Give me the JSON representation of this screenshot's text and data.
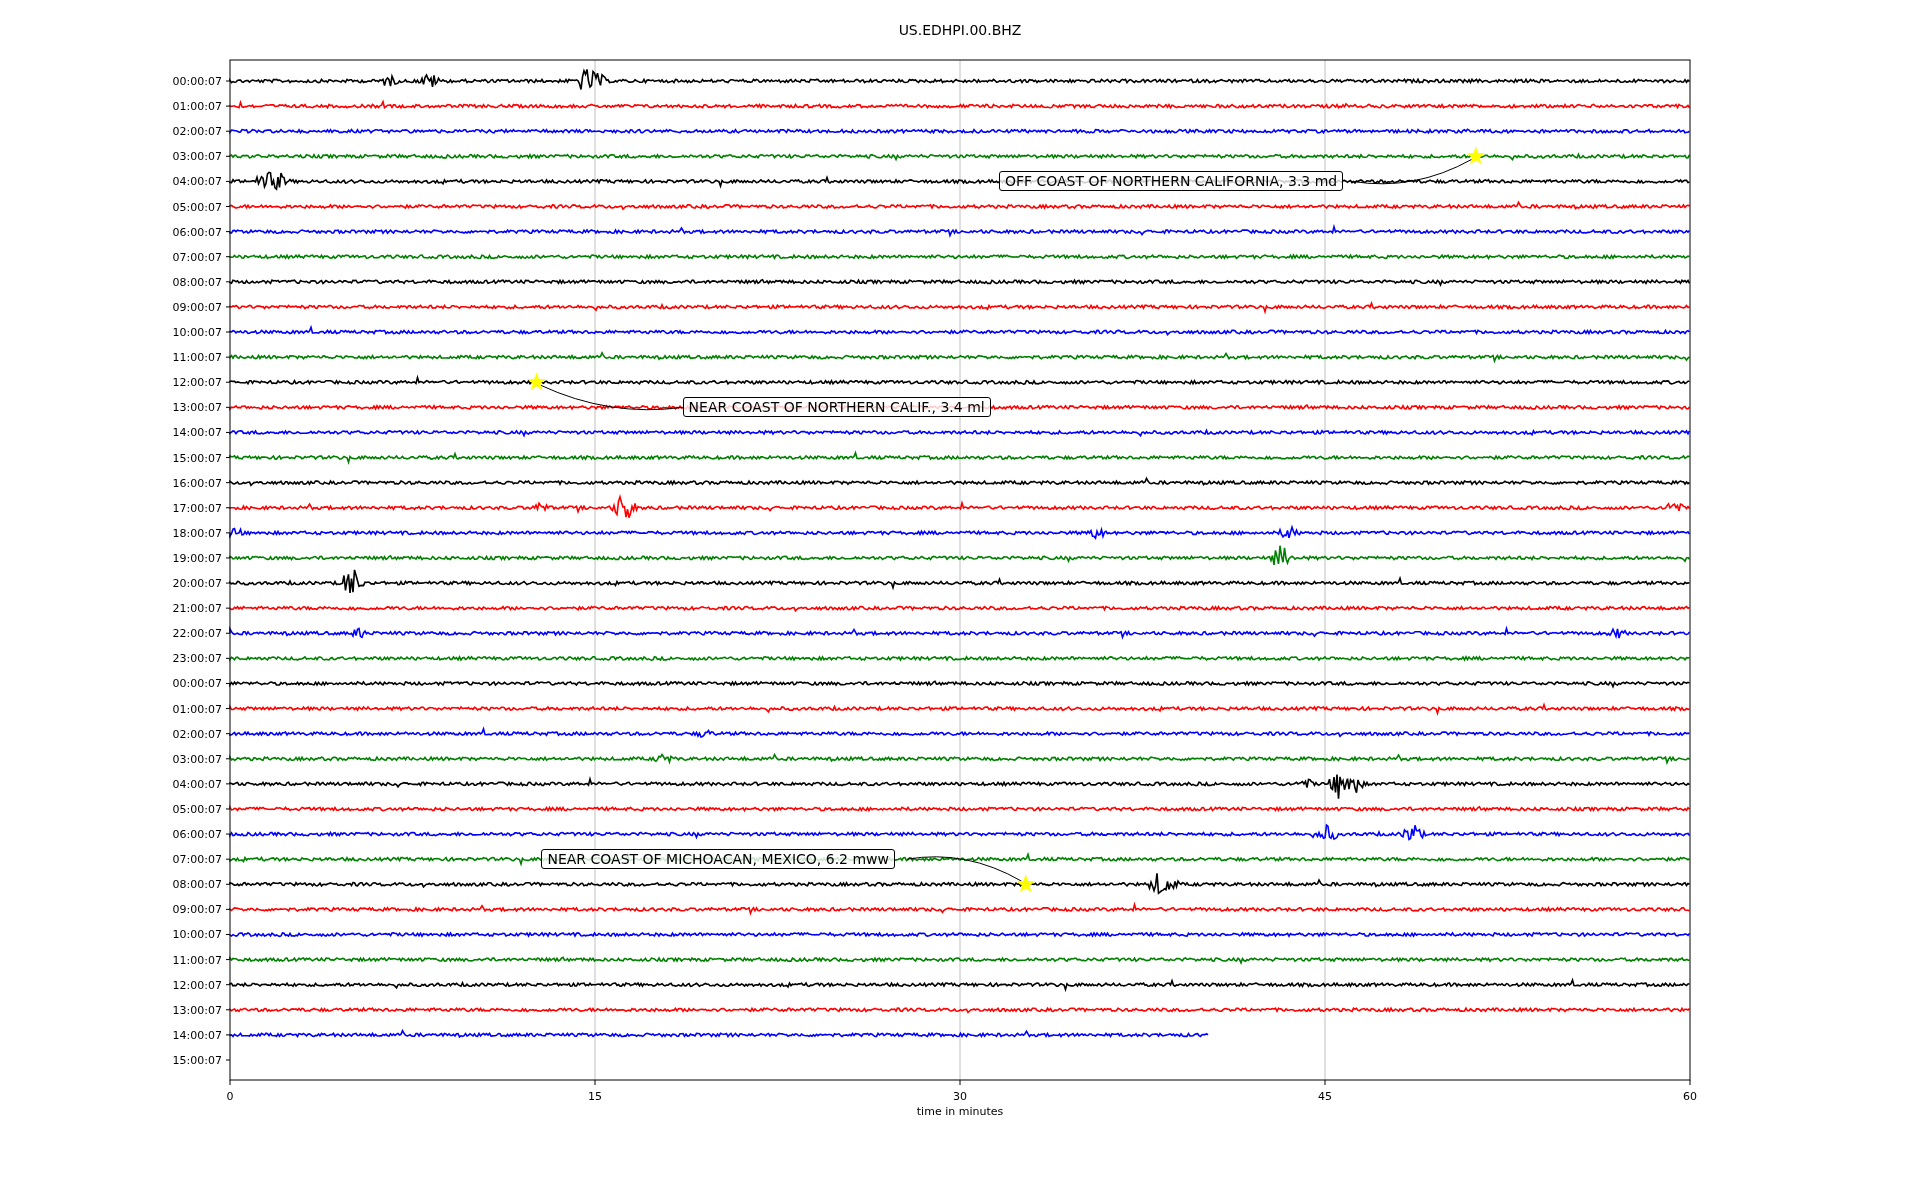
{
  "title": "US.EDHPI.00.BHZ",
  "rows": [
    {
      "label": "00:00:07",
      "color": "#000000",
      "level": 1
    },
    {
      "label": "01:00:07",
      "color": "#ff0000",
      "level": 1
    },
    {
      "label": "02:00:07",
      "color": "#0000ff",
      "level": 1
    },
    {
      "label": "03:00:07",
      "color": "#008000",
      "level": 1
    },
    {
      "label": "04:00:07",
      "color": "#000000",
      "level": 1
    },
    {
      "label": "05:00:07",
      "color": "#ff0000",
      "level": 1
    },
    {
      "label": "06:00:07",
      "color": "#0000ff",
      "level": 1
    },
    {
      "label": "07:00:07",
      "color": "#008000",
      "level": 1
    },
    {
      "label": "08:00:07",
      "color": "#000000",
      "level": 1
    },
    {
      "label": "09:00:07",
      "color": "#ff0000",
      "level": 1
    },
    {
      "label": "10:00:07",
      "color": "#0000ff",
      "level": 1
    },
    {
      "label": "11:00:07",
      "color": "#008000",
      "level": 1
    },
    {
      "label": "12:00:07",
      "color": "#000000",
      "level": 1
    },
    {
      "label": "13:00:07",
      "color": "#ff0000",
      "level": 1
    },
    {
      "label": "14:00:07",
      "color": "#0000ff",
      "level": 1
    },
    {
      "label": "15:00:07",
      "color": "#008000",
      "level": 1
    },
    {
      "label": "16:00:07",
      "color": "#000000",
      "level": 1
    },
    {
      "label": "17:00:07",
      "color": "#ff0000",
      "level": 1
    },
    {
      "label": "18:00:07",
      "color": "#0000ff",
      "level": 1
    },
    {
      "label": "19:00:07",
      "color": "#008000",
      "level": 1
    },
    {
      "label": "20:00:07",
      "color": "#000000",
      "level": 1
    },
    {
      "label": "21:00:07",
      "color": "#ff0000",
      "level": 1
    },
    {
      "label": "22:00:07",
      "color": "#0000ff",
      "level": 1
    },
    {
      "label": "23:00:07",
      "color": "#008000",
      "level": 1
    },
    {
      "label": "00:00:07",
      "color": "#000000",
      "level": 1
    },
    {
      "label": "01:00:07",
      "color": "#ff0000",
      "level": 1
    },
    {
      "label": "02:00:07",
      "color": "#0000ff",
      "level": 1
    },
    {
      "label": "03:00:07",
      "color": "#008000",
      "level": 1
    },
    {
      "label": "04:00:07",
      "color": "#000000",
      "level": 1
    },
    {
      "label": "05:00:07",
      "color": "#ff0000",
      "level": 1
    },
    {
      "label": "06:00:07",
      "color": "#0000ff",
      "level": 1
    },
    {
      "label": "07:00:07",
      "color": "#008000",
      "level": 1
    },
    {
      "label": "08:00:07",
      "color": "#000000",
      "level": 1
    },
    {
      "label": "09:00:07",
      "color": "#ff0000",
      "level": 1
    },
    {
      "label": "10:00:07",
      "color": "#0000ff",
      "level": 1
    },
    {
      "label": "11:00:07",
      "color": "#008000",
      "level": 1
    },
    {
      "label": "12:00:07",
      "color": "#000000",
      "level": 1
    },
    {
      "label": "13:00:07",
      "color": "#ff0000",
      "level": 1
    },
    {
      "label": "14:00:07",
      "color": "#0000ff",
      "level": 0.67
    },
    {
      "label": "15:00:07"
    }
  ],
  "xticks": [
    "0",
    "15",
    "30",
    "45",
    "60"
  ],
  "xlabel": "time in minutes",
  "events": [
    {
      "text": "OFF COAST OF NORTHERN CALIFORNIA, 3.3 md"
    },
    {
      "text": "NEAR COAST OF NORTHERN CALIF., 3.4 ml"
    },
    {
      "text": "NEAR COAST OF MICHOACAN, MEXICO, 6.2 mww"
    }
  ]
}
